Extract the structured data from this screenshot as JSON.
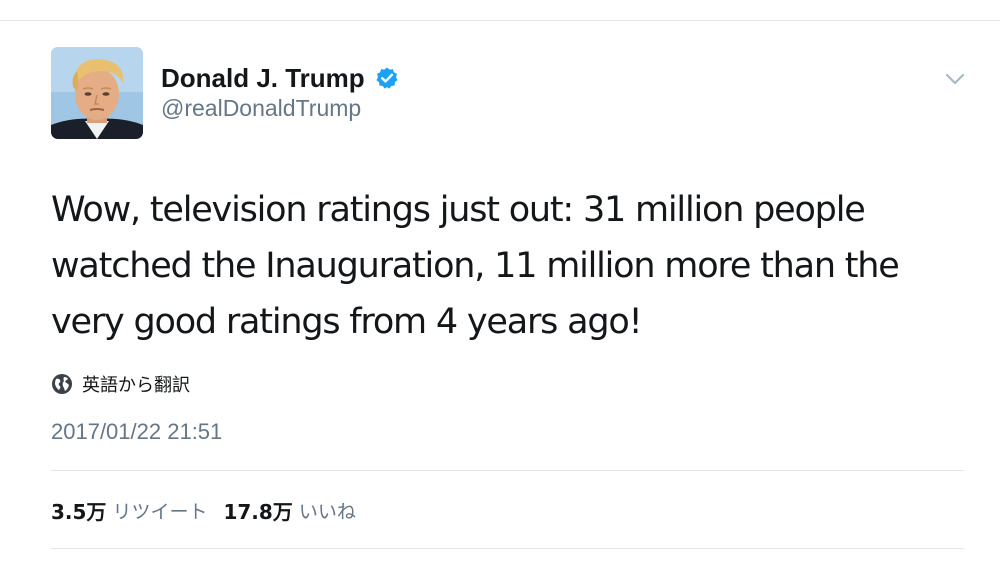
{
  "author": {
    "display_name": "Donald J. Trump",
    "handle": "@realDonaldTrump",
    "verified": true,
    "avatar_icon": "profile-photo"
  },
  "tweet": {
    "text": "Wow, television ratings just out: 31 million people watched the Inauguration, 11 million more than the very good ratings from 4 years ago!",
    "translate_label": "英語から翻訳",
    "timestamp": "2017/01/22 21:51"
  },
  "stats": {
    "retweets_count": "3.5万",
    "retweets_label": "リツイート",
    "likes_count": "17.8万",
    "likes_label": "いいね"
  },
  "colors": {
    "verified_blue": "#1da1f2",
    "secondary_text": "#657786",
    "primary_text": "#14171a",
    "divider": "#e1e8ed"
  },
  "icons": {
    "verified": "verified-badge-icon",
    "caret": "chevron-down-icon",
    "translate": "globe-icon"
  }
}
